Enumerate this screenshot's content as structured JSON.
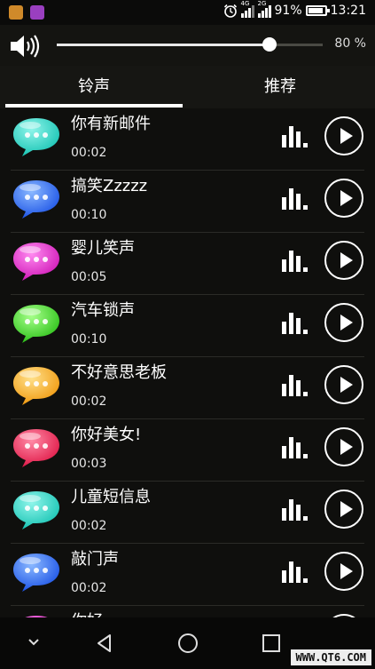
{
  "status_bar": {
    "app_icons": [
      "notification-app-icon-orange",
      "notification-app-icon-purple"
    ],
    "net_4g": "4G",
    "net_2g": "2G",
    "battery_pct": "91%",
    "battery_level": 0.91,
    "time": "13:21"
  },
  "volume": {
    "value": 0.8,
    "label": "80 %"
  },
  "tabs": [
    {
      "label": "铃声",
      "selected": true
    },
    {
      "label": "推荐",
      "selected": false
    }
  ],
  "ringtones": [
    {
      "title": "你有新邮件",
      "duration": "00:02",
      "color": "teal"
    },
    {
      "title": "搞笑Zzzzz",
      "duration": "00:10",
      "color": "blue"
    },
    {
      "title": "婴儿笑声",
      "duration": "00:05",
      "color": "magenta"
    },
    {
      "title": "汽车锁声",
      "duration": "00:10",
      "color": "green"
    },
    {
      "title": "不好意思老板",
      "duration": "00:02",
      "color": "orange"
    },
    {
      "title": "你好美女!",
      "duration": "00:03",
      "color": "red"
    },
    {
      "title": "儿童短信息",
      "duration": "00:02",
      "color": "teal"
    },
    {
      "title": "敲门声",
      "duration": "00:02",
      "color": "blue"
    },
    {
      "title": "你好",
      "duration": "",
      "color": "magenta"
    }
  ],
  "bubble_colors": {
    "teal": [
      "#8ff5ea",
      "#19c4b4"
    ],
    "blue": [
      "#8ab8ff",
      "#1e55e6"
    ],
    "magenta": [
      "#ff8af0",
      "#d01ab8"
    ],
    "green": [
      "#a6ff8a",
      "#2ec21a"
    ],
    "orange": [
      "#ffe08a",
      "#f09a10"
    ],
    "red": [
      "#ff8aa6",
      "#e01a48"
    ]
  },
  "watermark": "WWW.QT6.COM"
}
